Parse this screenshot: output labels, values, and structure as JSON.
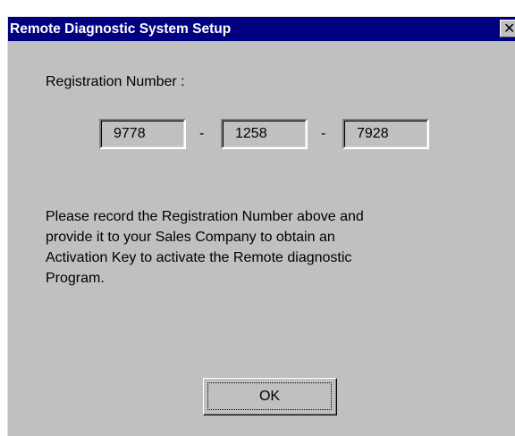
{
  "window": {
    "title": "Remote Diagnostic System Setup",
    "close_symbol": "✕"
  },
  "registration": {
    "label": "Registration Number :",
    "parts": [
      "9778",
      "1258",
      "7928"
    ],
    "separator": "-"
  },
  "message": {
    "lines": [
      "Please record the Registration Number above and",
      "provide it to your Sales Company to obtain an",
      "Activation Key to activate the Remote diagnostic",
      "Program."
    ]
  },
  "buttons": {
    "ok_label": "OK"
  },
  "colors": {
    "titlebar": "#000080",
    "face": "#c0c0c0"
  },
  "icons": {
    "close": "close-icon"
  }
}
